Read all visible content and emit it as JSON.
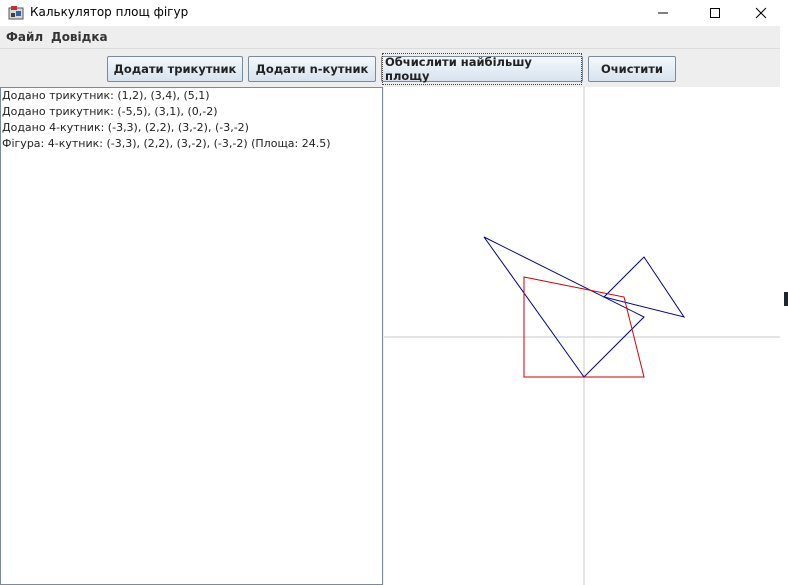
{
  "window": {
    "title": "Калькулятор площ фігур",
    "controls": {
      "minimize": "minimize-icon",
      "maximize": "maximize-icon",
      "close": "close-icon"
    }
  },
  "menu": {
    "items": [
      {
        "label": "Файл"
      },
      {
        "label": "Довідка"
      }
    ]
  },
  "toolbar": {
    "add_triangle": "Додати трикутник",
    "add_ngon": "Додати n-кутник",
    "compute_max": "Обчислити найбільшу площу",
    "clear": "Очистити"
  },
  "log": {
    "lines": [
      "Додано трикутник: (1,2), (3,4), (5,1)",
      "Додано трикутник: (-5,5), (3,1), (0,-2)",
      "Додано 4-кутник: (-3,3), (2,2), (3,-2), (-3,-2)",
      "Фігура: 4-кутник: (-3,3), (2,2), (3,-2), (-3,-2) (Площа: 24.5)"
    ]
  },
  "plot": {
    "axis_color": "#c8c8c8",
    "shapes": [
      {
        "kind": "triangle",
        "points": [
          [
            1,
            2
          ],
          [
            3,
            4
          ],
          [
            5,
            1
          ]
        ],
        "color": "#00008b"
      },
      {
        "kind": "triangle",
        "points": [
          [
            -5,
            5
          ],
          [
            3,
            1
          ],
          [
            0,
            -2
          ]
        ],
        "color": "#00008b"
      },
      {
        "kind": "polygon",
        "points": [
          [
            -3,
            3
          ],
          [
            2,
            2
          ],
          [
            3,
            -2
          ],
          [
            -3,
            -2
          ]
        ],
        "color": "#cc0000"
      }
    ]
  }
}
